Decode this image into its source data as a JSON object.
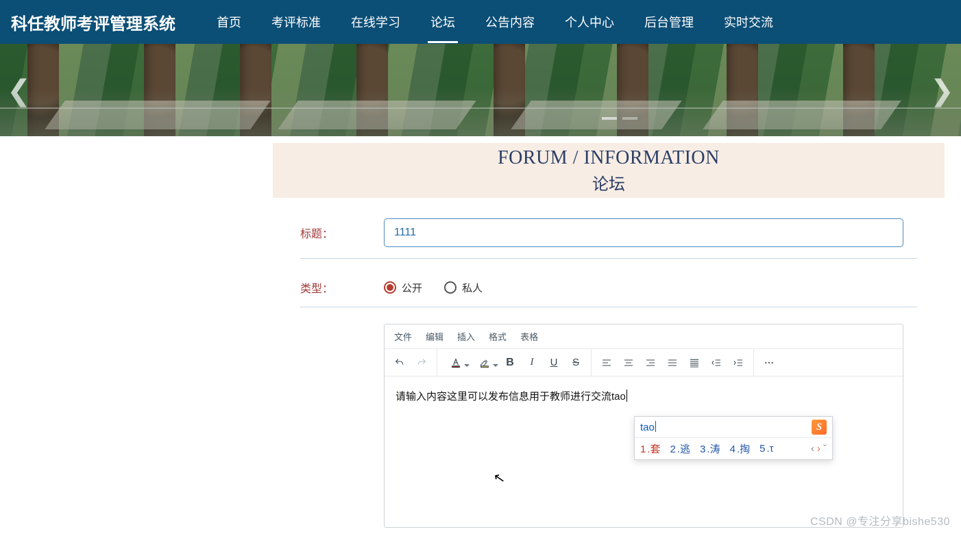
{
  "navbar": {
    "brand": "科任教师考评管理系统",
    "items": [
      "首页",
      "考评标准",
      "在线学习",
      "论坛",
      "公告内容",
      "个人中心",
      "后台管理",
      "实时交流"
    ],
    "active_index": 3
  },
  "band": {
    "en": "FORUM / INFORMATION",
    "cn": "论坛"
  },
  "form": {
    "title_label": "标题：",
    "title_value": "1111",
    "type_label": "类型：",
    "type_options": [
      "公开",
      "私人"
    ],
    "type_selected": "公开"
  },
  "editor": {
    "menus": [
      "文件",
      "编辑",
      "插入",
      "格式",
      "表格"
    ],
    "content": "请输入内容这里可以发布信息用于教师进行交流tao"
  },
  "ime": {
    "typed": "tao",
    "candidates": [
      {
        "n": "1",
        "w": "套"
      },
      {
        "n": "2",
        "w": "逃"
      },
      {
        "n": "3",
        "w": "涛"
      },
      {
        "n": "4",
        "w": "掏"
      },
      {
        "n": "5",
        "w": "τ"
      }
    ],
    "logo": "S"
  },
  "watermark": "CSDN @专注分享bishe530"
}
